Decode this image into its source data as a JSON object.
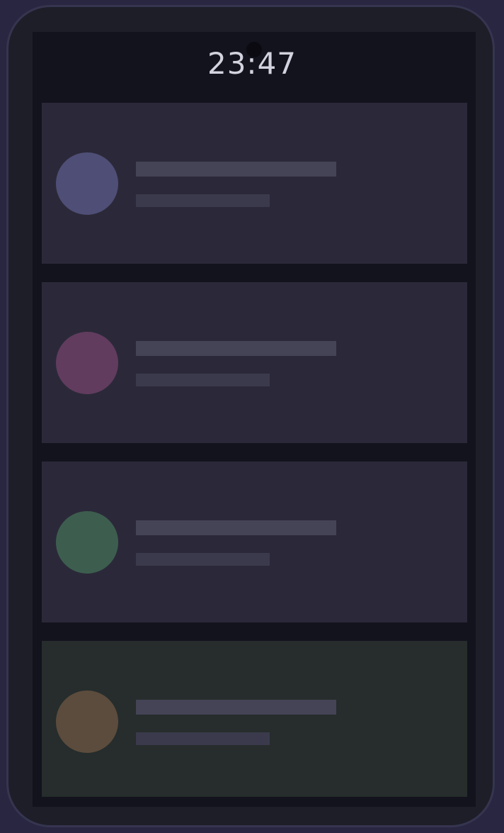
{
  "status_bar": {
    "time": "23:47"
  },
  "notifications": [
    {
      "avatar_color": "#4f4e76",
      "placeholder": true
    },
    {
      "avatar_color": "#613c5e",
      "placeholder": true
    },
    {
      "avatar_color": "#3d5e4f",
      "placeholder": true
    },
    {
      "avatar_color": "#5c4c3d",
      "placeholder": true,
      "highlighted": true
    }
  ],
  "colors": {
    "device_frame": "#1e1e29",
    "screen_bg": "#13131d",
    "card_bg": "#2b2939",
    "highlight_card_bg": "#262d2c",
    "skeleton_line": "#454456"
  }
}
